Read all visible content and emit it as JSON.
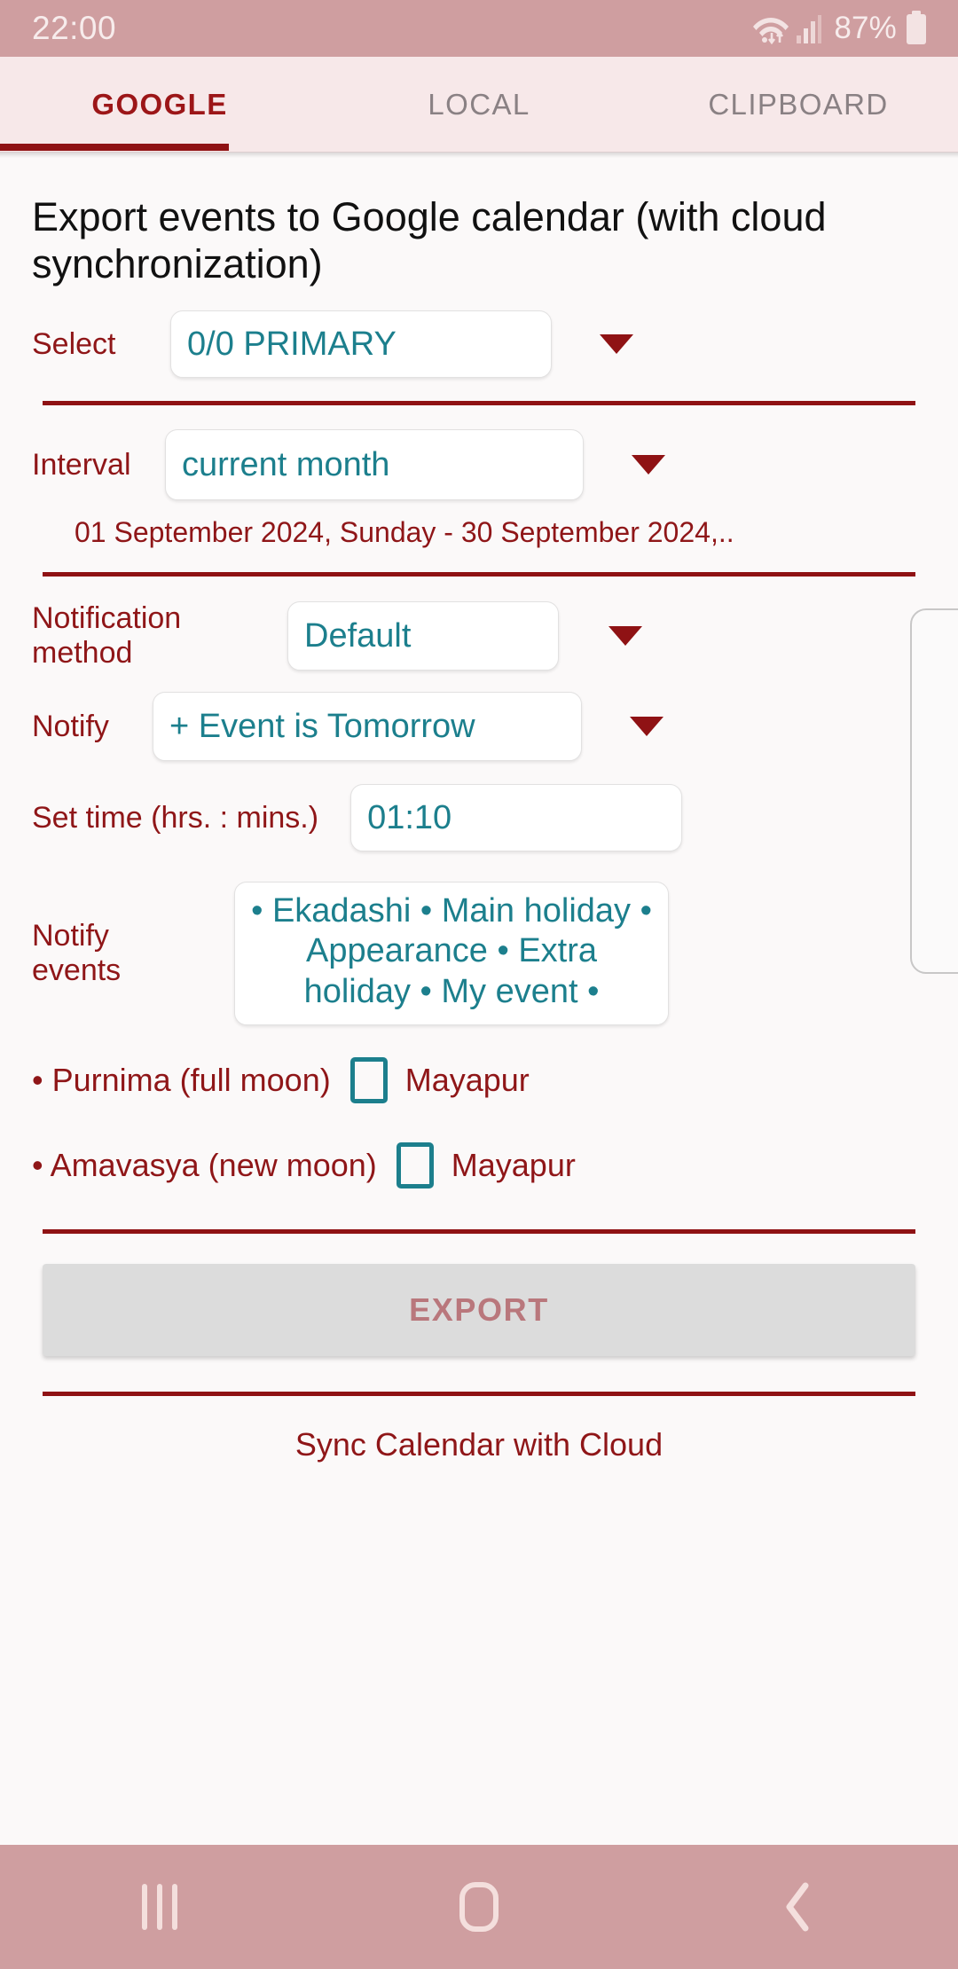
{
  "status_bar": {
    "time": "22:00",
    "battery_percent": "87%",
    "wifi_icon": "wifi-icon",
    "signal_icon": "cellular-signal-icon",
    "battery_icon": "battery-icon"
  },
  "tabs": [
    {
      "label": "GOOGLE",
      "active": true
    },
    {
      "label": "LOCAL",
      "active": false
    },
    {
      "label": "CLIPBOARD",
      "active": false
    }
  ],
  "main": {
    "title": "Export events to Google calendar (with cloud synchronization)",
    "select": {
      "label": "Select",
      "value": "0/0 PRIMARY"
    },
    "interval": {
      "label": "Interval",
      "value": "current month",
      "range": "01 September 2024, Sunday - 30 September 2024,.."
    },
    "notification_method": {
      "label": "Notification method",
      "value": "Default"
    },
    "notify": {
      "label": "Notify",
      "value": "+ Event is Tomorrow"
    },
    "set_time": {
      "label": "Set time (hrs. : mins.)",
      "value": "01:10"
    },
    "notify_events": {
      "label": "Notify events",
      "value": "• Ekadashi • Main holiday • Appearance • Extra holiday • My event •"
    },
    "moon_rows": [
      {
        "text": "• Purnima (full moon)",
        "checkbox_label": "Mayapur",
        "checked": false
      },
      {
        "text": "• Amavasya (new moon)",
        "checkbox_label": "Mayapur",
        "checked": false
      }
    ],
    "export_button": "EXPORT",
    "sync_link": "Sync Calendar with Cloud"
  },
  "nav_bar": {
    "recents": "recents-icon",
    "home": "home-icon",
    "back": "back-icon"
  },
  "colors": {
    "accent_maroon": "#8f1618",
    "teal": "#1c7f8d",
    "status_bar_pink": "#cf9ea0",
    "tab_bg": "#f7e8e9",
    "page_bg": "#fbf9f9",
    "export_disabled": "#dcdcdc"
  }
}
